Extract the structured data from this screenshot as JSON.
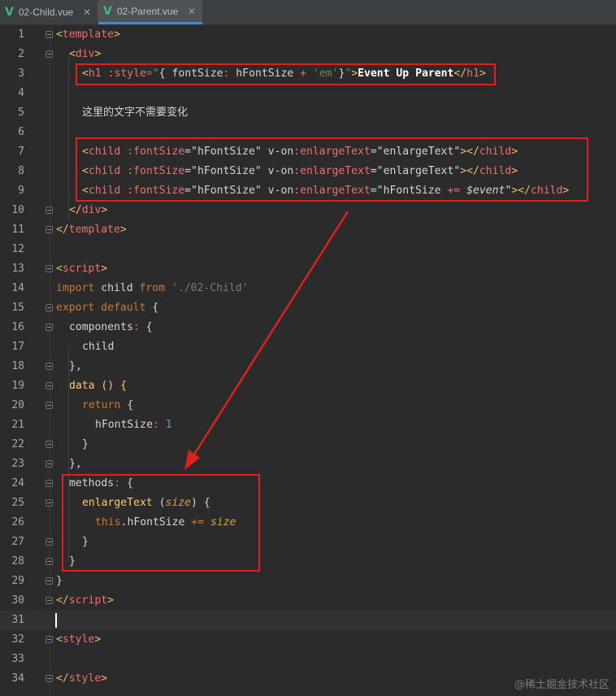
{
  "tabs": [
    {
      "icon": "vue-icon",
      "label": "02-Child.vue",
      "active": false
    },
    {
      "icon": "vue-icon",
      "label": "02-Parent.vue",
      "active": true
    }
  ],
  "editor": {
    "lines": [
      {
        "n": "1"
      },
      {
        "n": "2"
      },
      {
        "n": "3"
      },
      {
        "n": "4"
      },
      {
        "n": "5"
      },
      {
        "n": "6"
      },
      {
        "n": "7"
      },
      {
        "n": "8"
      },
      {
        "n": "9"
      },
      {
        "n": "10"
      },
      {
        "n": "11"
      },
      {
        "n": "12"
      },
      {
        "n": "13"
      },
      {
        "n": "14"
      },
      {
        "n": "15"
      },
      {
        "n": "16"
      },
      {
        "n": "17"
      },
      {
        "n": "18"
      },
      {
        "n": "19"
      },
      {
        "n": "20"
      },
      {
        "n": "21"
      },
      {
        "n": "22"
      },
      {
        "n": "23"
      },
      {
        "n": "24"
      },
      {
        "n": "25"
      },
      {
        "n": "26"
      },
      {
        "n": "27"
      },
      {
        "n": "28"
      },
      {
        "n": "29"
      },
      {
        "n": "30"
      },
      {
        "n": "31"
      },
      {
        "n": "32"
      },
      {
        "n": "33"
      },
      {
        "n": "34"
      }
    ],
    "current_line": "31",
    "code": {
      "l1": "template",
      "l2": "div",
      "l3_tag": "h1",
      "l3_attr": ":style",
      "l3_expr_open": "{ ",
      "l3_expr_var": "fontSize",
      "l3_expr_colon": ": ",
      "l3_expr_var2": "hFontSize",
      "l3_expr_plus": " + ",
      "l3_expr_str": "'em'",
      "l3_expr_close": "}",
      "l3_text": "Event Up Parent",
      "l5_text": "这里的文字不需要变化",
      "child_tag": "child",
      "child_attr1": ":fontSize",
      "child_val1": "hFontSize",
      "child_attr2": "v-on",
      "child_attr2b": "enlargeText",
      "child_val2": "enlargeText",
      "l9_val2a": "hFontSize ",
      "l9_val2b": "+=",
      "l9_val2c": "$event",
      "l14_import": "import",
      "l14_name": " child ",
      "l14_from": "from",
      "l14_path": "'./02-Child'",
      "l15_export": "export default",
      "l15_brace": " {",
      "l16": "components",
      "l17": "child",
      "l18": "},",
      "l19": "data () {",
      "l20_kw": "return",
      "l20_brace": " {",
      "l21_prop": "hFontSize",
      "l21_num": "1",
      "l22": "}",
      "l23": "},",
      "l24": "methods",
      "l25_fn": "enlargeText",
      "l25_param": "size",
      "l26_this": "this",
      "l26_prop": "hFontSize",
      "l26_op": "+=",
      "l26_param": "size",
      "l27": "}",
      "l28": "}",
      "l29": "}",
      "l30": "script",
      "l13": "script",
      "l32": "style",
      "l34": "style"
    }
  },
  "annotations": {
    "box_color": "#e0201d",
    "arrow": "from line 9 highlight to methods highlight"
  },
  "watermark": "@稀土掘金技术社区"
}
